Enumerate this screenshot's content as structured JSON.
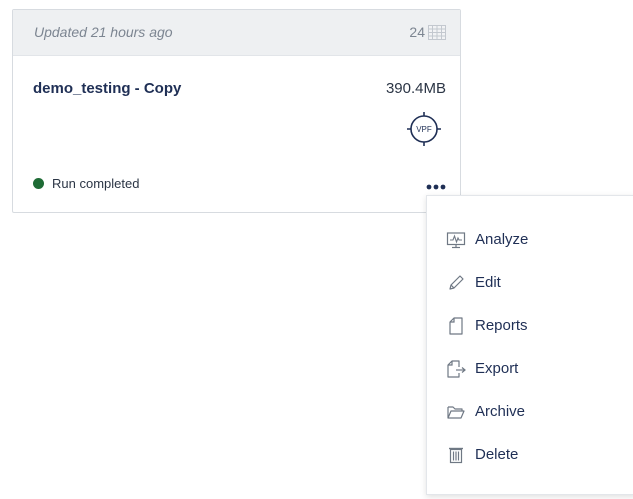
{
  "card": {
    "updated": "Updated 21 hours ago",
    "count": "24",
    "name": "demo_testing - Copy",
    "size": "390.4MB",
    "badge": "VPF",
    "status": "Run completed",
    "status_color": "#1e6b35"
  },
  "menu": {
    "items": [
      {
        "label": "Analyze",
        "icon": "analyze-icon"
      },
      {
        "label": "Edit",
        "icon": "pencil-icon"
      },
      {
        "label": "Reports",
        "icon": "reports-icon"
      },
      {
        "label": "Export",
        "icon": "export-icon"
      },
      {
        "label": "Archive",
        "icon": "folder-icon"
      },
      {
        "label": "Delete",
        "icon": "trash-icon"
      }
    ]
  }
}
